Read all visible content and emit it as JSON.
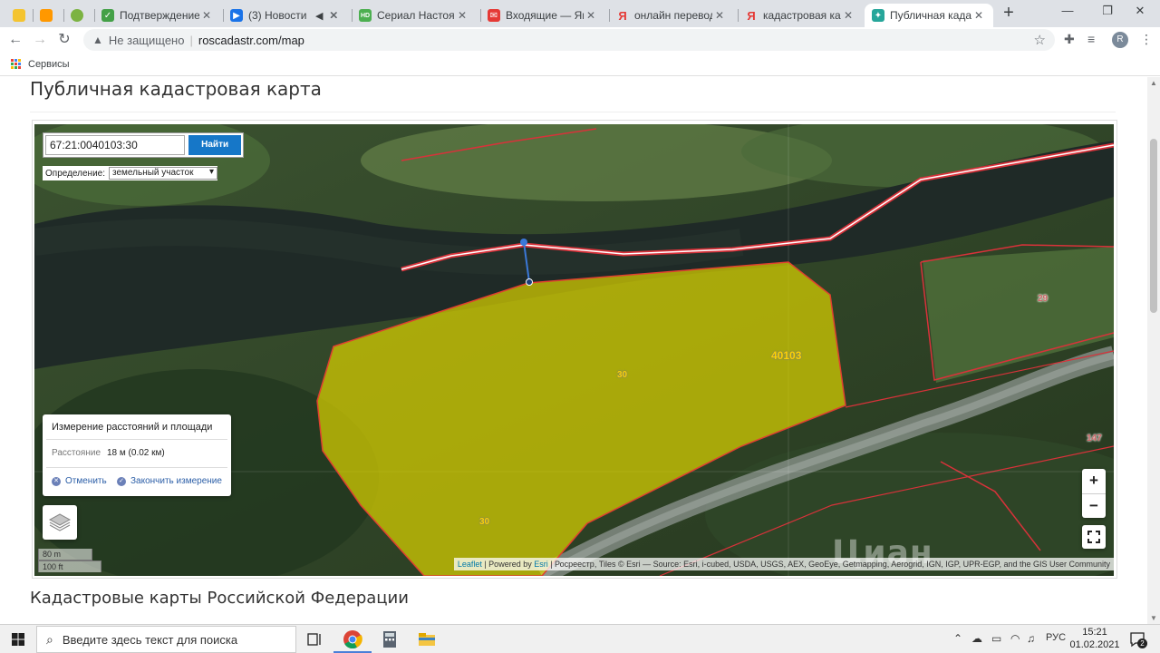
{
  "tabs": [
    {
      "title": "",
      "favicon_color": "#f4c430",
      "icon": "bulb"
    },
    {
      "title": "",
      "favicon_color": "#ff9800",
      "icon": "pencil"
    },
    {
      "title": "",
      "favicon_color": "#7cb342",
      "icon": "dots"
    },
    {
      "title": "Подтверждение да",
      "favicon_color": "#43a047",
      "icon": "check"
    },
    {
      "title": "(3) Новости",
      "favicon_color": "#1a73e8",
      "icon": "play"
    },
    {
      "title": "",
      "favicon_color": "#5f6368",
      "icon": "speaker"
    },
    {
      "title": "Сериал Настоящий",
      "favicon_color": "#4caf50",
      "icon": "hd"
    },
    {
      "title": "Входящие — Яндек",
      "favicon_color": "#e53935",
      "icon": "mail"
    },
    {
      "title": "онлайн переводчи",
      "favicon_color": "#e53935",
      "icon": "yandex"
    },
    {
      "title": "кадастровая карта",
      "favicon_color": "#e53935",
      "icon": "yandex"
    },
    {
      "title": "Публичная кадастр",
      "favicon_color": "#26a69a",
      "icon": "star"
    }
  ],
  "address_bar": {
    "security": "Не защищено",
    "url": "roscadastr.com/map"
  },
  "profile_initial": "R",
  "bookmarks": {
    "apps_label": "Сервисы"
  },
  "page": {
    "title": "Публичная кадастровая карта",
    "section_title": "Кадастровые карты Российской Федерации"
  },
  "map": {
    "search_value": "67:21:0040103:30",
    "search_button": "Найти",
    "definition_label": "Определение:",
    "definition_selected": "земельный участок",
    "measure": {
      "title": "Измерение расстояний и площади",
      "distance_label": "Расстояние",
      "distance_value": "18 м (0.02 км)",
      "cancel_label": "Отменить",
      "finish_label": "Закончить измерение"
    },
    "scale": {
      "metric": "80 m",
      "imperial": "100 ft"
    },
    "zoom_in": "+",
    "zoom_out": "−",
    "parcel_labels": {
      "main_a": "30",
      "main_b": "30",
      "block": "40103",
      "right": "29",
      "far_right": "147"
    },
    "watermark": "Циан",
    "attribution": {
      "leaflet": "Leaflet",
      "powered": " | Powered by ",
      "esri": "Esri",
      "rest": " | Росреестр, Tiles © Esri — Source: Esri, i-cubed, USDA, USGS, AEX, GeoEye, Getmapping, Aerogrid, IGN, IGP, UPR-EGP, and the GIS User Community"
    }
  },
  "taskbar": {
    "search_placeholder": "Введите здесь текст для поиска",
    "language": "РУС",
    "time": "15:21",
    "date": "01.02.2021",
    "notifications": "2"
  }
}
